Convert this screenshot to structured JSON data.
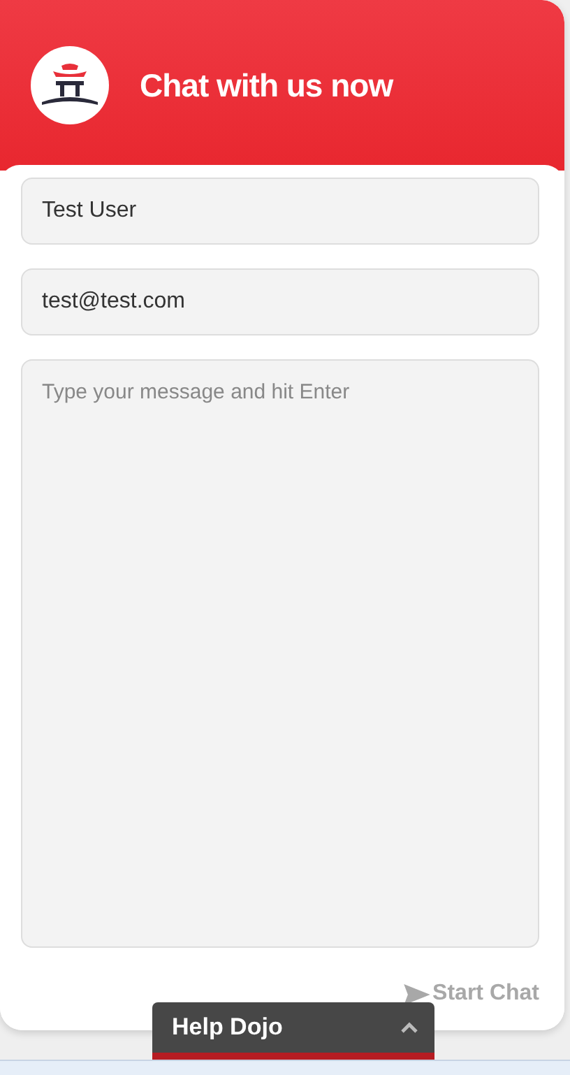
{
  "header": {
    "title": "Chat with us now"
  },
  "fields": [
    {
      "kind": "input",
      "value": "Test User"
    },
    {
      "kind": "input",
      "value": "test@test.com"
    },
    {
      "kind": "textarea",
      "placeholder": "Type your message and hit Enter"
    }
  ],
  "start_button": {
    "label": "Start Chat",
    "disabled": true
  },
  "help_widget": {
    "label": "Help Dojo",
    "expanded": false
  }
}
